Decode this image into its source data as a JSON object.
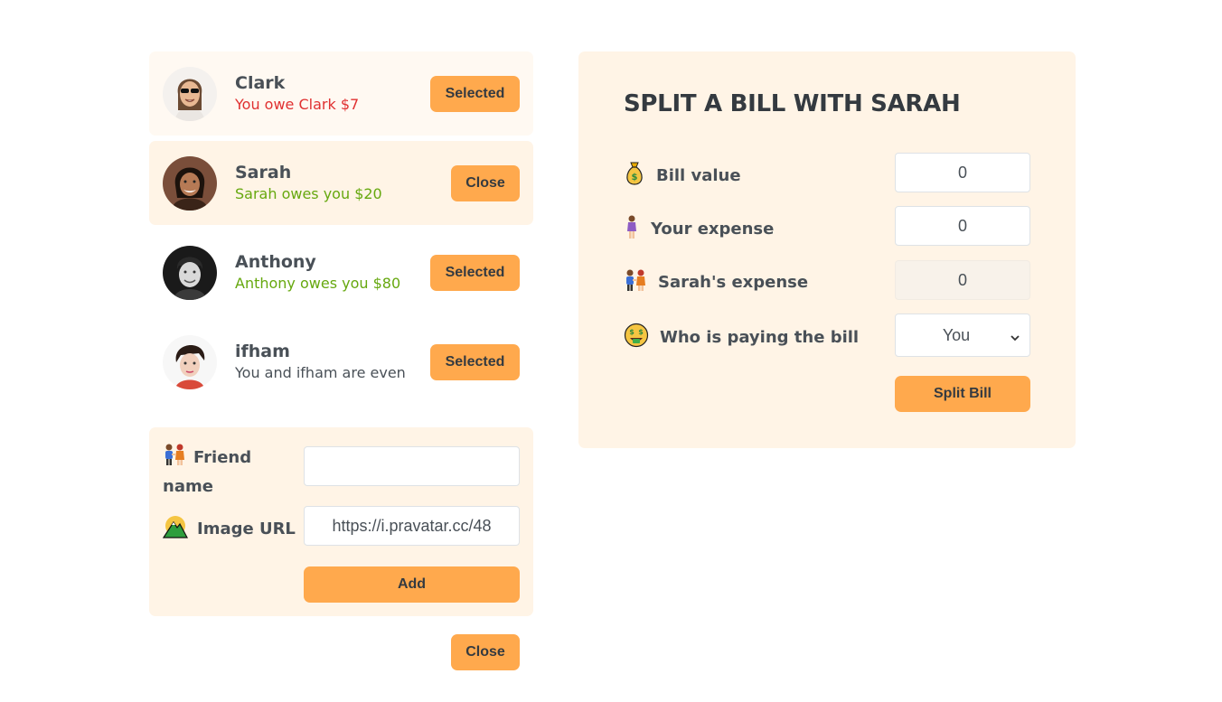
{
  "friends": [
    {
      "name": "Clark",
      "balance": "You owe Clark $7",
      "status": "owe",
      "button": "Selected"
    },
    {
      "name": "Sarah",
      "balance": "Sarah owes you $20",
      "status": "owed",
      "button": "Close"
    },
    {
      "name": "Anthony",
      "balance": "Anthony owes you $80",
      "status": "owed",
      "button": "Selected"
    },
    {
      "name": "ifham",
      "balance": "You and ifham are even",
      "status": "even",
      "button": "Selected"
    }
  ],
  "add_friend": {
    "name_label": "Friend name",
    "name_icon": "people-holding-hands-icon",
    "name_value": "",
    "url_label": "Image URL",
    "url_icon": "mountain-icon",
    "url_value": "https://i.pravatar.cc/48",
    "add_label": "Add"
  },
  "close_label": "Close",
  "split": {
    "title": "SPLIT A BILL WITH SARAH",
    "bill_label": "Bill value",
    "bill_icon": "money-bag-icon",
    "bill_value": "0",
    "your_label": "Your expense",
    "your_icon": "woman-standing-icon",
    "your_value": "0",
    "friend_label": "Sarah's expense",
    "friend_icon": "people-holding-hands-icon",
    "friend_value": "0",
    "payer_label": "Who is paying the bill",
    "payer_icon": "money-mouth-face-icon",
    "payer_value": "You",
    "submit_label": "Split Bill"
  },
  "colors": {
    "accent": "#ffa94d",
    "panel": "#fff4e6",
    "owe_red": "#e03131",
    "owed_green": "#66a80f"
  }
}
